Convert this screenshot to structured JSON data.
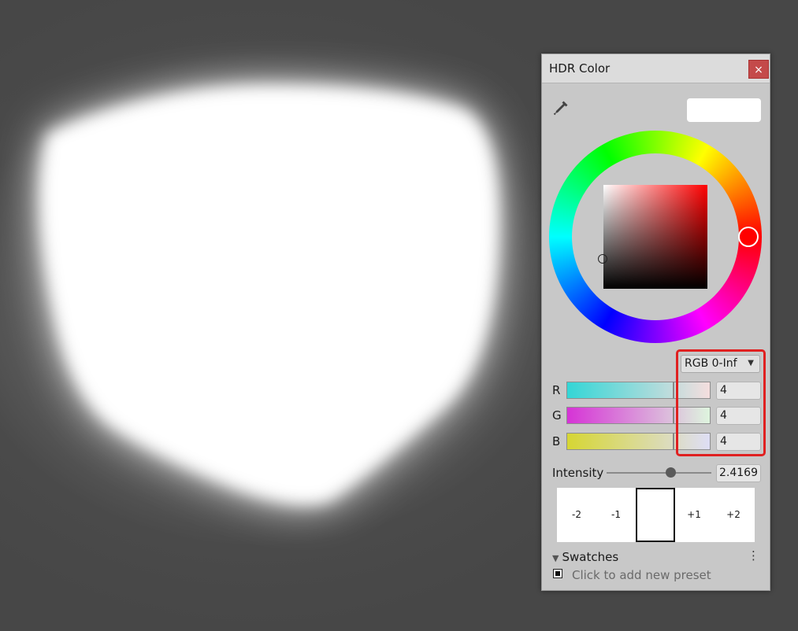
{
  "window": {
    "title": "HDR Color",
    "close_label": "×"
  },
  "preview": {
    "color": "#ffffff"
  },
  "color_picker": {
    "hue_color": "#ff0000"
  },
  "mode": {
    "selected": "RGB 0-Inf"
  },
  "channels": [
    {
      "label": "R",
      "value": "4",
      "gradient_from": "#33d6d6",
      "gradient_to": "#f5dede"
    },
    {
      "label": "G",
      "value": "4",
      "gradient_from": "#d633d6",
      "gradient_to": "#def5de"
    },
    {
      "label": "B",
      "value": "4",
      "gradient_from": "#d6d633",
      "gradient_to": "#dedef5"
    }
  ],
  "intensity": {
    "label": "Intensity",
    "value": "2.4169"
  },
  "exposure_steps": [
    "-2",
    "-1",
    "",
    "+1",
    "+2"
  ],
  "swatches": {
    "header": "Swatches",
    "add_preset": "Click to add new preset"
  },
  "icons": {
    "eyedropper": "eyedropper-icon",
    "menu": "kebab-menu-icon",
    "collapse": "triangle-down-icon"
  }
}
